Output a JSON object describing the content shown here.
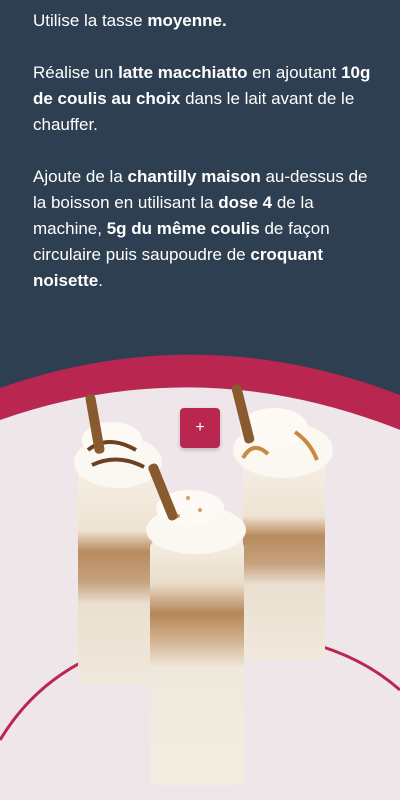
{
  "instructions": {
    "p1": {
      "a": "Utilise la tasse ",
      "b": "moyenne."
    },
    "p2": {
      "a": "Réalise un ",
      "b": "latte macchiatto",
      "c": " en ajoutant ",
      "d": "10g de coulis au choix",
      "e": " dans le lait avant de le chauffer."
    },
    "p3": {
      "a": "Ajoute de la ",
      "b": "chantilly maison",
      "c": " au-dessus de la boisson en utilisant la ",
      "d": "dose 4",
      "e": " de la machine, ",
      "f": "5g du même coulis",
      "g": " de façon circulaire puis saupoudre de ",
      "h": "croquant noisette",
      "i": "."
    }
  },
  "plus_button": {
    "label": "+"
  },
  "colors": {
    "panel": "#2d3f51",
    "accent": "#b9264f",
    "background": "#efe6ea"
  },
  "image": {
    "subject": "three latte macchiato glasses with whipped cream, caramel drizzle and wafer rolls"
  }
}
